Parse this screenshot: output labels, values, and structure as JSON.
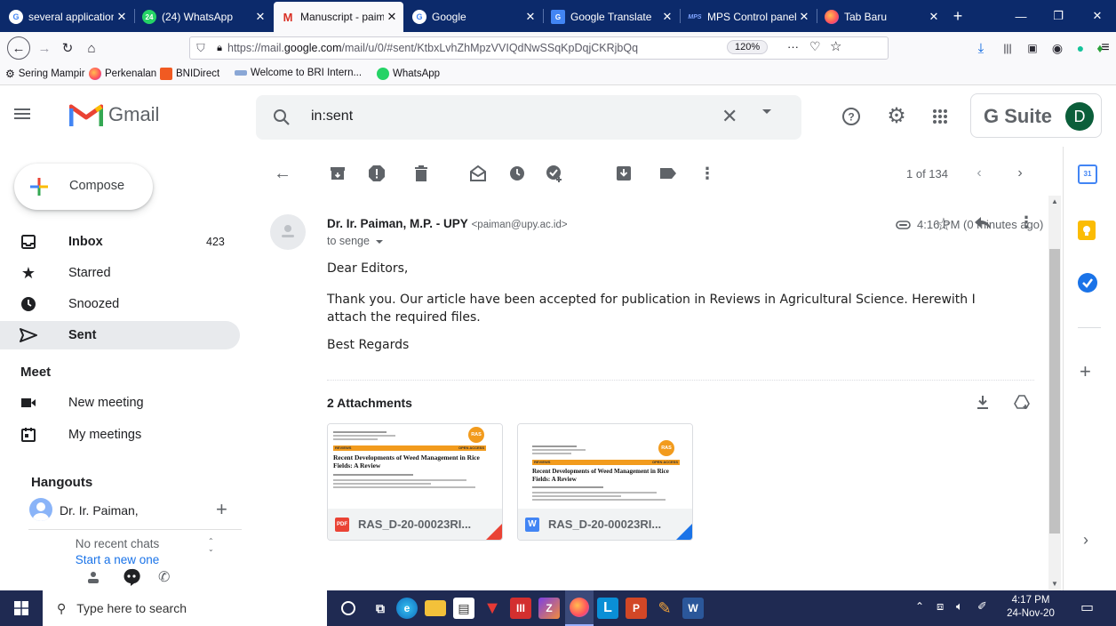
{
  "browser": {
    "tabs": [
      {
        "title": "several application f",
        "icon": "google-icon",
        "active": false
      },
      {
        "title": "(24) WhatsApp",
        "icon": "whatsapp-icon",
        "active": false
      },
      {
        "title": "Manuscript - paima",
        "icon": "gmail-icon",
        "active": true
      },
      {
        "title": "Google",
        "icon": "google-icon",
        "active": false
      },
      {
        "title": "Google Translate",
        "icon": "translate-icon",
        "active": false
      },
      {
        "title": "MPS Control panel",
        "icon": "mps-icon",
        "active": false
      },
      {
        "title": "Tab Baru",
        "icon": "firefox-icon",
        "active": false
      }
    ],
    "new_tab": "+",
    "url_prefix": "https://mail.",
    "url_domain": "google.com",
    "url_rest": "/mail/u/0/#sent/KtbxLvhZhMpzVVIQdNwSSqKpDqjCKRjbQq",
    "zoom": "120%",
    "bookmarks": [
      "Sering Mampir",
      "Perkenalan",
      "BNIDirect",
      "Welcome to BRI Intern...",
      "WhatsApp"
    ]
  },
  "gmail": {
    "logo_text": "Gmail",
    "search_value": "in:sent",
    "gsuite_label": "G Suite",
    "avatar_letter": "D",
    "compose_label": "Compose",
    "nav": [
      {
        "label": "Inbox",
        "count": "423",
        "bold": true
      },
      {
        "label": "Starred",
        "count": ""
      },
      {
        "label": "Snoozed",
        "count": ""
      },
      {
        "label": "Sent",
        "count": "",
        "bold": true
      }
    ],
    "meet_heading": "Meet",
    "meet_items": [
      "New meeting",
      "My meetings"
    ],
    "hangouts_heading": "Hangouts",
    "hangouts_user": "Dr. Ir. Paiman,",
    "no_chats": "No recent chats",
    "start_chat": "Start a new one",
    "pagination": "1 of 134"
  },
  "email": {
    "sender_name": "Dr. Ir. Paiman, M.P. - UPY",
    "sender_email": "<paiman@upy.ac.id>",
    "time": "4:16 PM (0 minutes ago)",
    "to_line": "to senge",
    "greeting": "Dear Editors,",
    "body": "Thank you. Our article have been accepted for publication in Reviews in Agricultural Science.  Herewith I attach the required files.",
    "closing": "Best Regards",
    "attachments_heading": "2 Attachments",
    "attachments": [
      {
        "name": "RAS_D-20-00023RI...",
        "type_badge": "PDF",
        "accent": "#ea4335",
        "preview_title": "Recent Developments of Weed Management in Rice Fields: A Review",
        "preview_band_left": "REVIEWS",
        "preview_band_right": "OPEN ACCESS",
        "preview_logo": "RAS"
      },
      {
        "name": "RAS_D-20-00023RI...",
        "type_badge": "W",
        "accent": "#1a73e8",
        "preview_title": "Recent Developments of Weed Management in Rice Fields: A Review",
        "preview_band_left": "REVIEWS",
        "preview_band_right": "OPEN ACCESS",
        "preview_logo": "RAS"
      }
    ]
  },
  "taskbar": {
    "search_placeholder": "Type here to search",
    "time": "4:17 PM",
    "date": "24-Nov-20"
  },
  "colors": {
    "tab_strip": "#0c2a6b",
    "taskbar": "#1f2a52",
    "sent_highlight": "#e8eaed",
    "gsuite_avatar": "#0b5e3a"
  }
}
